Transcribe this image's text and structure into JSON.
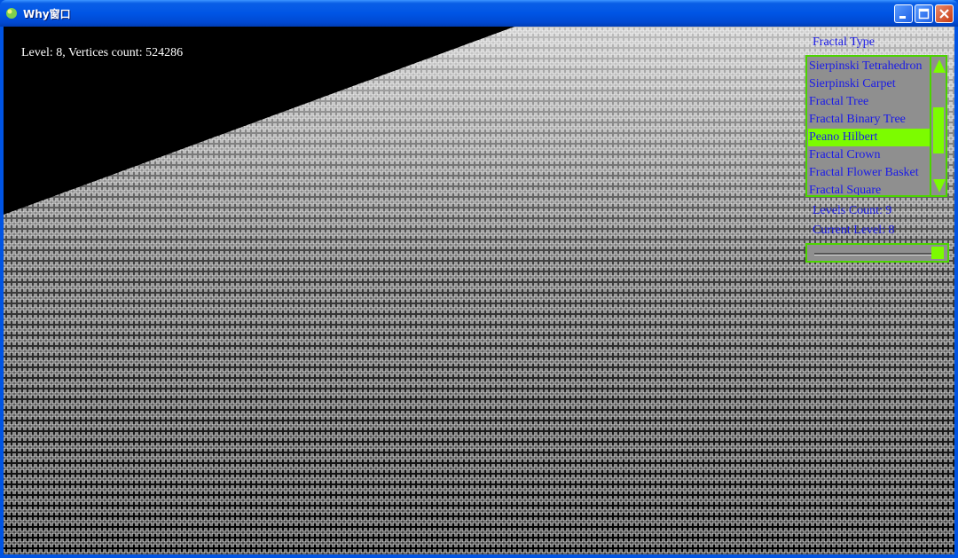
{
  "window": {
    "title": "Why窗口"
  },
  "titlebar_buttons": {
    "minimize": "minimize-icon",
    "maximize": "maximize-icon",
    "close": "close-icon"
  },
  "viewport": {
    "status": "Level: 8, Vertices count: 524286"
  },
  "panel": {
    "fractal_type_label": "Fractal Type",
    "fractal_types": [
      "Sierpinski Tetrahedron",
      "Sierpinski Carpet",
      "Fractal Tree",
      "Fractal Binary Tree",
      "Peano Hilbert",
      "Fractal Crown",
      "Fractal Flower Basket",
      "Fractal Square"
    ],
    "selected_fractal": "Peano Hilbert",
    "levels_count_label": "Levels Count: 9",
    "current_level_label": "Current Level: 8",
    "level_slider_value": 8,
    "level_slider_max": 8
  },
  "colors": {
    "accent_green": "#7cfc00",
    "border_green": "#4cd400",
    "list_text": "#1a1ae8",
    "panel_bg": "#8f8f8f"
  }
}
